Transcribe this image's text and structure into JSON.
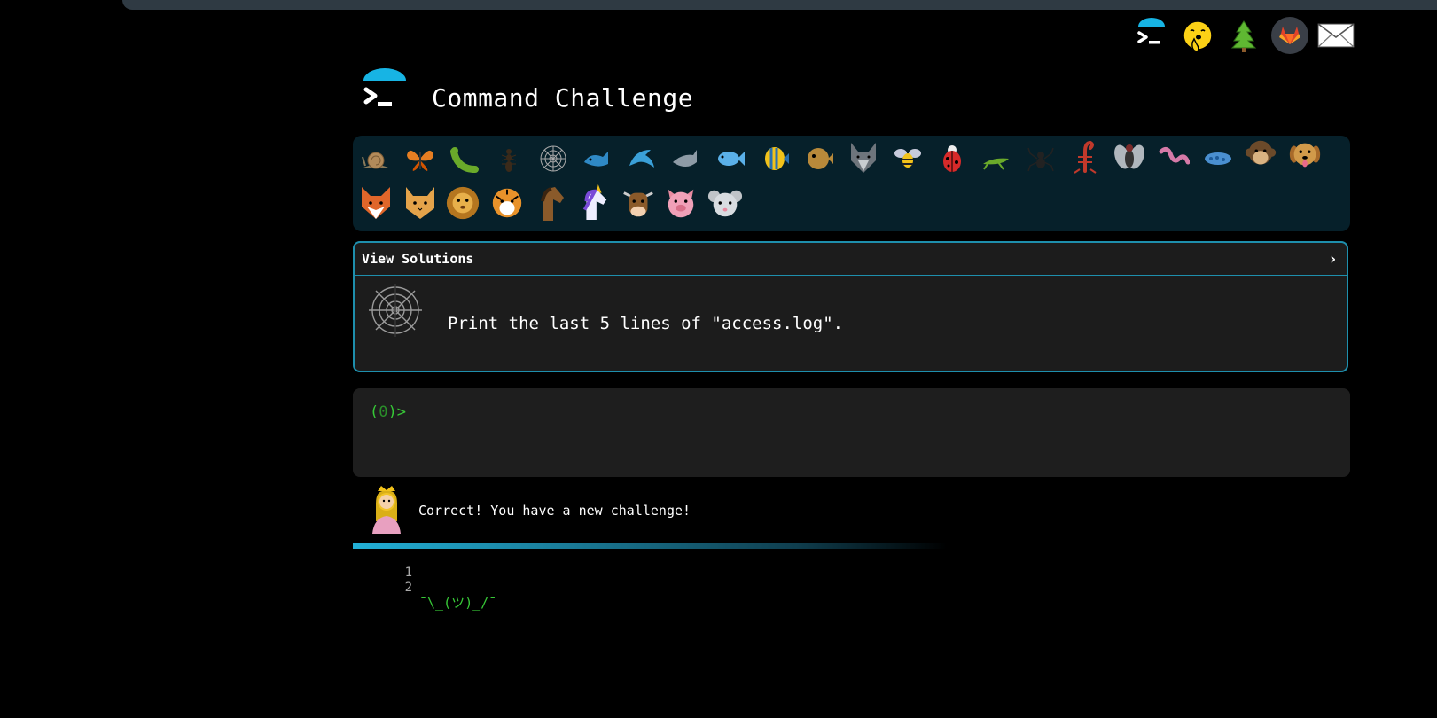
{
  "app": {
    "title": "Command Challenge"
  },
  "top_nav": {
    "icons": [
      "terminal-logo-icon",
      "shushing-face-icon",
      "evergreen-tree-icon",
      "gitlab-icon",
      "envelope-icon"
    ]
  },
  "animals_row1": [
    "snail",
    "butterfly",
    "bug",
    "ant",
    "spider-web",
    "whale",
    "dolphin",
    "dolphin-gray",
    "fish",
    "tropical-fish",
    "blowfish",
    "wolf",
    "bee",
    "ladybug",
    "cricket",
    "spider",
    "scorpion",
    "fly",
    "worm",
    "microbe",
    "monkey",
    "dog"
  ],
  "animals_row2": [
    "fox",
    "cat",
    "lion",
    "tiger",
    "horse",
    "unicorn",
    "cow",
    "pig",
    "mouse"
  ],
  "solutions": {
    "label": "View Solutions",
    "chevron": "›",
    "challenge": "Print the last 5 lines of \"access.log\"."
  },
  "terminal": {
    "prompt_open": "(",
    "prompt_count": "0",
    "prompt_close": ")>"
  },
  "status": {
    "message": "Correct! You have a new challenge!"
  },
  "output": {
    "line_numbers": [
      "1",
      "2"
    ],
    "line1": "¯\\_(ツ)_/¯",
    "line2": ""
  },
  "colors": {
    "accent": "#1e8fad",
    "prompt_green": "#37c837",
    "panel_bg": "#06202a",
    "card_bg": "#1c1c1c"
  }
}
